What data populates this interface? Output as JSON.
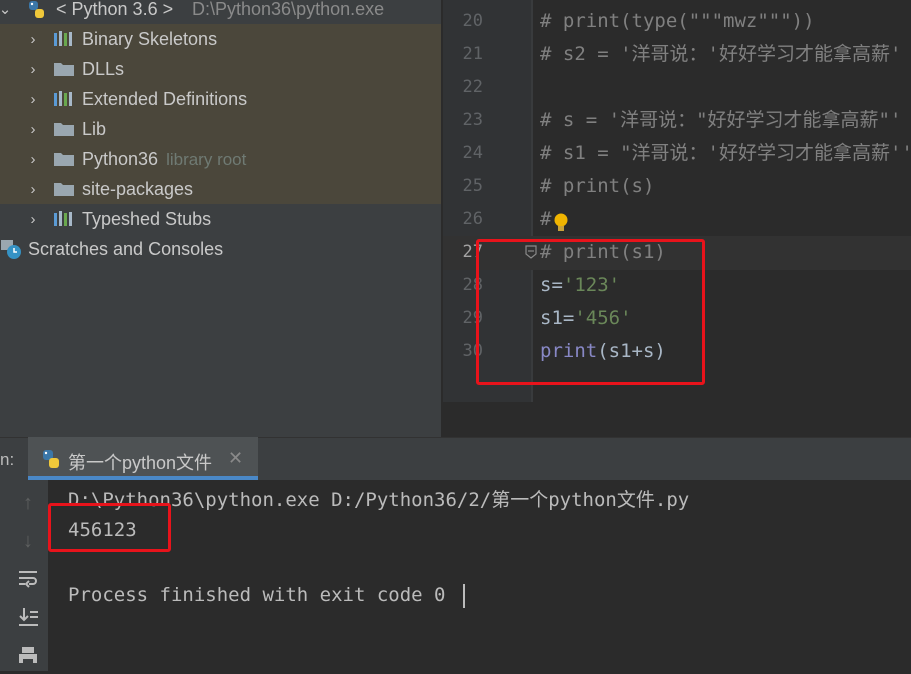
{
  "project_tree": {
    "root": {
      "label": "< Python 3.6 >",
      "path": "D:\\Python36\\python.exe"
    },
    "items": [
      {
        "label": "Binary Skeletons",
        "icon": "library-icon",
        "sublabel": ""
      },
      {
        "label": "DLLs",
        "icon": "folder-icon",
        "sublabel": ""
      },
      {
        "label": "Extended Definitions",
        "icon": "library-icon",
        "sublabel": ""
      },
      {
        "label": "Lib",
        "icon": "folder-icon",
        "sublabel": ""
      },
      {
        "label": "Python36",
        "icon": "folder-icon",
        "sublabel": "library root"
      },
      {
        "label": "site-packages",
        "icon": "folder-icon",
        "sublabel": ""
      },
      {
        "label": "Typeshed Stubs",
        "icon": "library-icon",
        "sublabel": ""
      }
    ],
    "scratches": "Scratches and Consoles"
  },
  "editor": {
    "line_numbers": [
      "20",
      "21",
      "22",
      "23",
      "24",
      "25",
      "26",
      "27",
      "28",
      "29",
      "30"
    ],
    "current_line": "27",
    "lines": {
      "l20": "# print(type(\"\"\"mwz\"\"\"))",
      "l21": "# s2 = '洋哥说：'好好学习才能拿高薪'",
      "l22": "",
      "l23": "# s = '洋哥说：\"好好学习才能拿高薪\"'",
      "l24": "# s1 = \"洋哥说：'好好学习才能拿高薪''",
      "l25": "# print(s)",
      "l26": "#",
      "l27": "# print(s1)",
      "l28_a": "s=",
      "l28_b": "'123'",
      "l29_a": "s1=",
      "l29_b": "'456'",
      "l30_a": "print",
      "l30_b": "(s1+s)"
    }
  },
  "run_panel": {
    "label_prefix": "n:",
    "tab_label": "第一个python文件",
    "command": "D:\\Python36\\python.exe D:/Python36/2/第一个python文件.py",
    "output": "456123",
    "exit_message": "Process finished with exit code 0"
  },
  "colors": {
    "highlight_box": "#e8131b",
    "tab_underline": "#4a88c7",
    "string": "#6a8759",
    "comment": "#808080",
    "builtin": "#8888c6"
  }
}
